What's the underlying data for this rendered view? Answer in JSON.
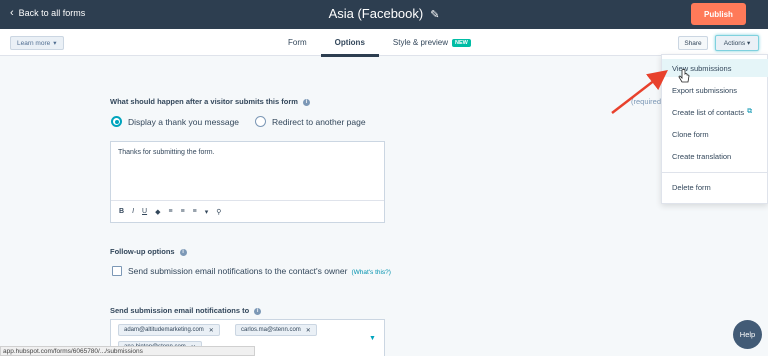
{
  "topbar": {
    "back_label": "Back to all forms",
    "form_title": "Asia (Facebook)",
    "publish_label": "Publish"
  },
  "subnav": {
    "learn_more": "Learn more",
    "tabs": [
      {
        "label": "Form"
      },
      {
        "label": "Options"
      },
      {
        "label": "Style & preview"
      }
    ],
    "new_badge": "NEW",
    "share_label": "Share",
    "actions_label": "Actions"
  },
  "actions_menu": {
    "items": [
      "View submissions",
      "Export submissions",
      "Create list of contacts",
      "Clone form",
      "Create translation",
      "Delete form"
    ]
  },
  "ghost_text": "(required)",
  "after_submit": {
    "question": "What should happen after a visitor submits this form",
    "option_thankyou": "Display a thank you message",
    "option_redirect": "Redirect to another page",
    "message": "Thanks for submitting the form."
  },
  "editor_tools": [
    "B",
    "I",
    "U",
    "◆",
    "≡",
    "≡",
    "≡",
    "▾",
    "⚲"
  ],
  "followup": {
    "label": "Follow-up options",
    "checkbox_label": "Send submission email notifications to the contact's owner",
    "whats_this": "(What's this?)"
  },
  "notifications": {
    "label": "Send submission email notifications to",
    "recipients": [
      "adam@altitudemarketing.com",
      "carlos.ma@stenn.com",
      "ana.hinton@stenn.com"
    ]
  },
  "status_url": "app.hubspot.com/forms/6065780/.../submissions",
  "help_label": "Help",
  "colors": {
    "topbar": "#2d3e50",
    "publish": "#ff7a59",
    "accent": "#00a4bd",
    "new_badge": "#00bda5",
    "annotation_arrow": "#e8412c"
  }
}
